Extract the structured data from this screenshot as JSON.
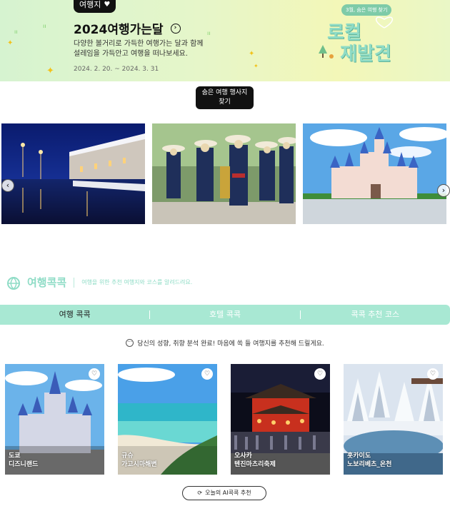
{
  "banner": {
    "tag": "여행지",
    "title": "2024여행가는달",
    "desc_line1": "다양한 볼거리로 가득한 여행가는 달과 함께",
    "desc_line2": "설레임을 가득안고 여행을 떠나보세요.",
    "date": "2024. 2. 20. ~ 2024. 3. 31",
    "badge": "3월, 숨은 여행 찾기",
    "logo_line1": "로컬",
    "logo_line2": "재발견"
  },
  "hidden_event_button": {
    "line1": "숨은 여행 행사지",
    "line2": "찾기"
  },
  "carousel": {
    "slides": [
      {
        "icon": "night-canal-photo"
      },
      {
        "icon": "festival-parade-photo"
      },
      {
        "icon": "castle-photo"
      }
    ]
  },
  "section": {
    "title": "여행콕콕",
    "subtitle": "여행을 위한 추천 여행지와 코스를 알려드려요."
  },
  "tabs": [
    "여행 콕콕",
    "호텔 콕콕",
    "콕콕 추천 코스"
  ],
  "recommend_text": "당신의 성향, 취향 분석 완료! 마음에 쏙 들 여행지를 추천해 드릴게요.",
  "cards": [
    {
      "region": "도쿄",
      "name": "디즈니랜드"
    },
    {
      "region": "규슈",
      "name": "가고시마해변"
    },
    {
      "region": "오사카",
      "name": "텐진마츠리축제"
    },
    {
      "region": "홋카이도",
      "name": "노보리베츠_온천"
    }
  ],
  "ai_button": "오늘의 AI콕콕 추천",
  "colors": {
    "mint": "#a8e8d3",
    "mint_text": "#8fdcc6",
    "dark": "#111111"
  }
}
